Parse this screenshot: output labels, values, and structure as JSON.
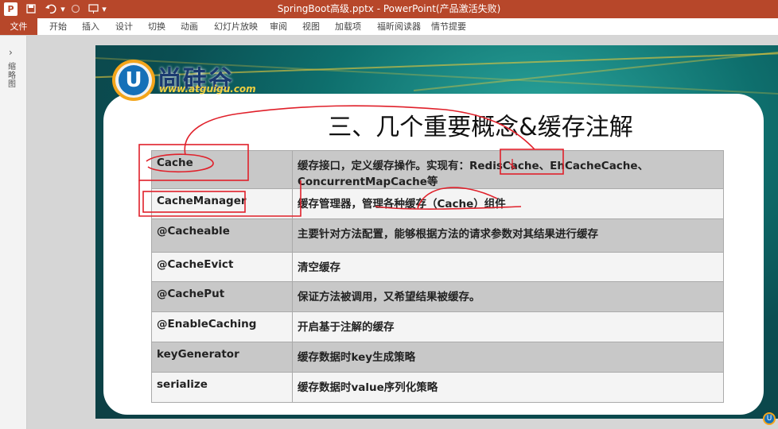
{
  "titlebar": {
    "title": "SpringBoot高级.pptx - PowerPoint(产品激活失败)",
    "app_icon": "P",
    "icons": [
      "save-icon",
      "undo-icon",
      "redo-icon",
      "customize-icon"
    ]
  },
  "ribbon": {
    "tabs": [
      "文件",
      "开始",
      "插入",
      "设计",
      "切换",
      "动画",
      "幻灯片放映",
      "审阅",
      "视图",
      "加载项",
      "福昕阅读器",
      "情节提要"
    ]
  },
  "leftpane": {
    "chevron": "›",
    "label": "缩略图"
  },
  "slide": {
    "logo_name": "尚硅谷",
    "logo_url": "www.atguigu.com",
    "title": "三、几个重要概念&缓存注解",
    "rows": [
      {
        "key": "Cache",
        "value": "缓存接口，定义缓存操作。实现有：RedisCache、EhCacheCache、ConcurrentMapCache等"
      },
      {
        "key": "CacheManager",
        "value": "缓存管理器，管理各种缓存（Cache）组件"
      },
      {
        "key": "@Cacheable",
        "value": "主要针对方法配置，能够根据方法的请求参数对其结果进行缓存"
      },
      {
        "key": "@CacheEvict",
        "value": "清空缓存"
      },
      {
        "key": "@CachePut",
        "value": "保证方法被调用，又希望结果被缓存。"
      },
      {
        "key": "@EnableCaching",
        "value": "开启基于注解的缓存"
      },
      {
        "key": "keyGenerator",
        "value": "缓存数据时key生成策略"
      },
      {
        "key": "serialize",
        "value": "缓存数据时value序列化策略"
      }
    ]
  },
  "colors": {
    "accent": "#b7472a",
    "annotation": "#e0202a"
  }
}
